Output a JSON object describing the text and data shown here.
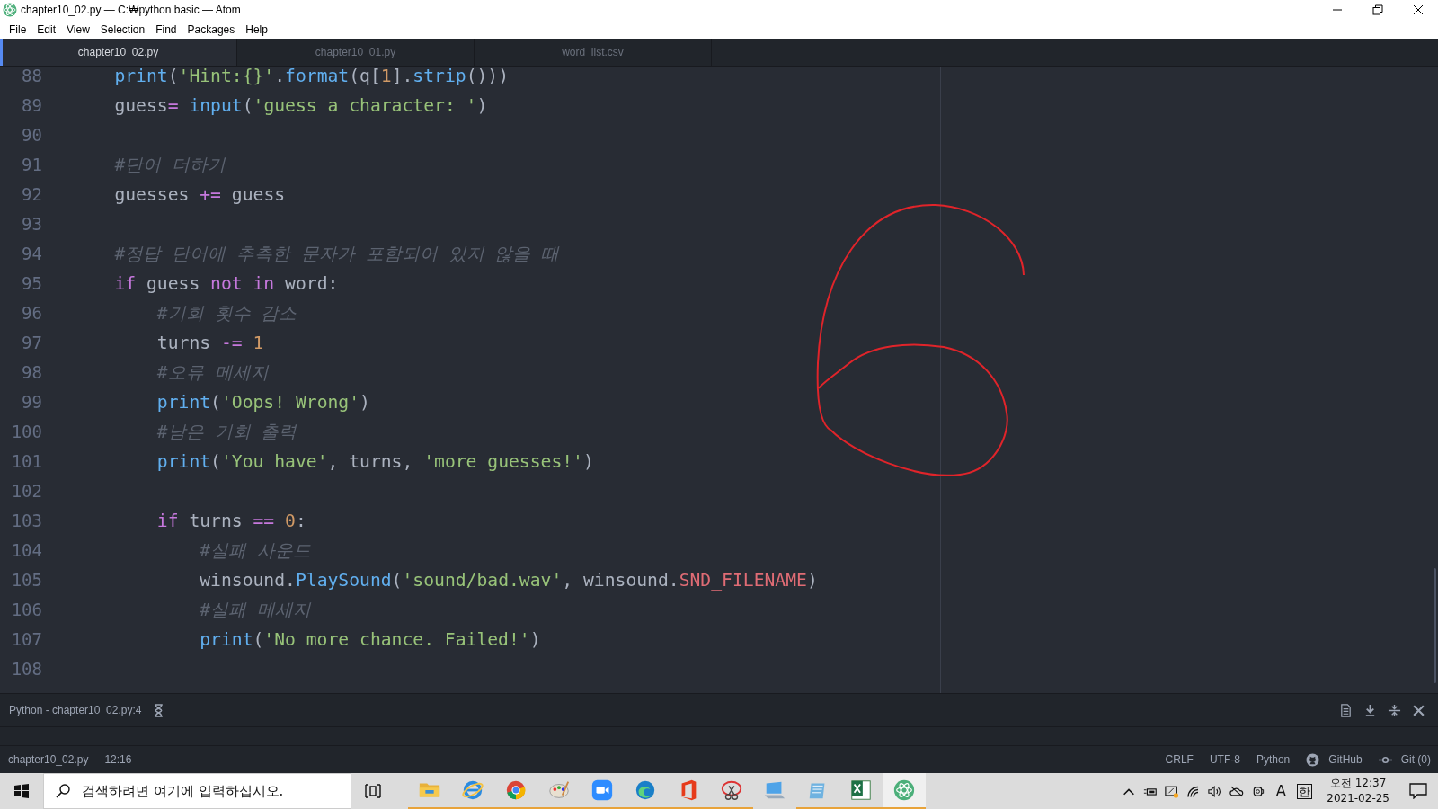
{
  "window": {
    "title": "chapter10_02.py — C:₩python basic — Atom"
  },
  "menu": [
    "File",
    "Edit",
    "View",
    "Selection",
    "Find",
    "Packages",
    "Help"
  ],
  "tabs": [
    {
      "label": "chapter10_02.py",
      "selected": true
    },
    {
      "label": "chapter10_01.py",
      "selected": false
    },
    {
      "label": "word_list.csv",
      "selected": false
    }
  ],
  "editor": {
    "lines": [
      {
        "number": "88",
        "tokens": [
          {
            "kind": "fn",
            "text": "    print"
          },
          {
            "kind": "plain",
            "text": "("
          },
          {
            "kind": "str",
            "text": "'Hint:{}'"
          },
          {
            "kind": "plain",
            "text": "."
          },
          {
            "kind": "fn",
            "text": "format"
          },
          {
            "kind": "plain",
            "text": "(q["
          },
          {
            "kind": "num",
            "text": "1"
          },
          {
            "kind": "plain",
            "text": "]."
          },
          {
            "kind": "fn",
            "text": "strip"
          },
          {
            "kind": "plain",
            "text": "()))"
          }
        ]
      },
      {
        "number": "89",
        "tokens": [
          {
            "kind": "plain",
            "text": "    guess"
          },
          {
            "kind": "op",
            "text": "= "
          },
          {
            "kind": "fn",
            "text": "input"
          },
          {
            "kind": "plain",
            "text": "("
          },
          {
            "kind": "str",
            "text": "'guess a character: '"
          },
          {
            "kind": "plain",
            "text": ")"
          }
        ]
      },
      {
        "number": "90"
      },
      {
        "number": "91",
        "tokens": [
          {
            "kind": "comment",
            "text": "    #단어 더하기"
          }
        ]
      },
      {
        "number": "92",
        "tokens": [
          {
            "kind": "plain",
            "text": "    guesses "
          },
          {
            "kind": "op",
            "text": "+="
          },
          {
            "kind": "plain",
            "text": " guess"
          }
        ]
      },
      {
        "number": "93"
      },
      {
        "number": "94",
        "tokens": [
          {
            "kind": "comment",
            "text": "    #정답 단어에 추측한 문자가 포함되어 있지 않을 때"
          }
        ]
      },
      {
        "number": "95",
        "tokens": [
          {
            "kind": "kw",
            "text": "    if"
          },
          {
            "kind": "plain",
            "text": " guess "
          },
          {
            "kind": "kw",
            "text": "not in"
          },
          {
            "kind": "plain",
            "text": " word:"
          }
        ]
      },
      {
        "number": "96",
        "tokens": [
          {
            "kind": "comment",
            "text": "        #기회 횟수 감소"
          }
        ]
      },
      {
        "number": "97",
        "tokens": [
          {
            "kind": "plain",
            "text": "        turns "
          },
          {
            "kind": "op",
            "text": "-="
          },
          {
            "kind": "num",
            "text": " 1"
          }
        ]
      },
      {
        "number": "98",
        "tokens": [
          {
            "kind": "comment",
            "text": "        #오류 메세지"
          }
        ]
      },
      {
        "number": "99",
        "tokens": [
          {
            "kind": "fn",
            "text": "        print"
          },
          {
            "kind": "plain",
            "text": "("
          },
          {
            "kind": "str",
            "text": "'Oops! Wrong'"
          },
          {
            "kind": "plain",
            "text": ")"
          }
        ]
      },
      {
        "number": "100",
        "tokens": [
          {
            "kind": "comment",
            "text": "        #남은 기회 출력"
          }
        ]
      },
      {
        "number": "101",
        "tokens": [
          {
            "kind": "fn",
            "text": "        print"
          },
          {
            "kind": "plain",
            "text": "("
          },
          {
            "kind": "str",
            "text": "'You have'"
          },
          {
            "kind": "plain",
            "text": ", turns, "
          },
          {
            "kind": "str",
            "text": "'more guesses!'"
          },
          {
            "kind": "plain",
            "text": ")"
          }
        ]
      },
      {
        "number": "102"
      },
      {
        "number": "103",
        "tokens": [
          {
            "kind": "kw",
            "text": "        if"
          },
          {
            "kind": "plain",
            "text": " turns "
          },
          {
            "kind": "op",
            "text": "=="
          },
          {
            "kind": "num",
            "text": " 0"
          },
          {
            "kind": "plain",
            "text": ":"
          }
        ]
      },
      {
        "number": "104",
        "tokens": [
          {
            "kind": "comment",
            "text": "            #실패 사운드"
          }
        ]
      },
      {
        "number": "105",
        "tokens": [
          {
            "kind": "plain",
            "text": "            winsound."
          },
          {
            "kind": "fn",
            "text": "PlaySound"
          },
          {
            "kind": "plain",
            "text": "("
          },
          {
            "kind": "str",
            "text": "'sound/bad.wav'"
          },
          {
            "kind": "plain",
            "text": ", winsound."
          },
          {
            "kind": "const",
            "text": "SND_FILENAME"
          },
          {
            "kind": "plain",
            "text": ")"
          }
        ]
      },
      {
        "number": "106",
        "tokens": [
          {
            "kind": "comment",
            "text": "            #실패 메세지"
          }
        ]
      },
      {
        "number": "107",
        "tokens": [
          {
            "kind": "fn",
            "text": "            print"
          },
          {
            "kind": "plain",
            "text": "("
          },
          {
            "kind": "str",
            "text": "'No more chance. Failed!'"
          },
          {
            "kind": "plain",
            "text": ")"
          }
        ]
      },
      {
        "number": "108"
      }
    ]
  },
  "panel": {
    "label": "Python - chapter10_02.py:4"
  },
  "status_bar": {
    "file": "chapter10_02.py",
    "cursor": "12:16",
    "line_ending": "CRLF",
    "encoding": "UTF-8",
    "grammar": "Python",
    "github": "GitHub",
    "git": "Git (0)"
  },
  "taskbar": {
    "search": {
      "placeholder": "검색하려면 여기에 입력하십시오."
    },
    "apps": [
      {
        "kind": "folder",
        "open": true,
        "selected": false
      },
      {
        "kind": "ie",
        "open": true,
        "selected": false
      },
      {
        "kind": "chrome",
        "open": true,
        "selected": false
      },
      {
        "kind": "paint",
        "open": true,
        "selected": false
      },
      {
        "kind": "zoom",
        "open": true,
        "selected": false
      },
      {
        "kind": "edge",
        "open": true,
        "selected": false
      },
      {
        "kind": "office",
        "open": true,
        "selected": false
      },
      {
        "kind": "snip",
        "open": true,
        "selected": false
      },
      {
        "kind": "pc",
        "open": false,
        "selected": false
      },
      {
        "kind": "calc",
        "open": true,
        "selected": false
      },
      {
        "kind": "excel",
        "open": true,
        "selected": false
      },
      {
        "kind": "atom",
        "open": true,
        "selected": true
      }
    ],
    "ime": "A",
    "lang": "한",
    "time": "오전 12:37",
    "date": "2021-02-25"
  }
}
